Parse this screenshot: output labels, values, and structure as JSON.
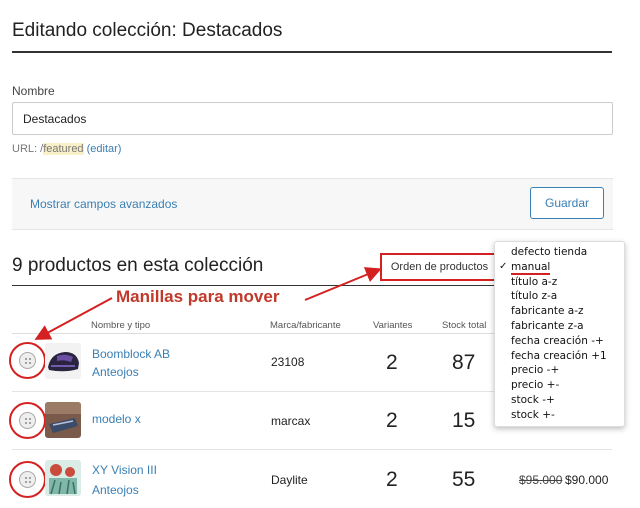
{
  "page": {
    "title": "Editando colección: Destacados"
  },
  "form": {
    "name_label": "Nombre",
    "name_value": "Destacados",
    "url_prefix": "URL: /",
    "url_path": "featured",
    "url_edit": "(editar)",
    "advanced_link": "Mostrar campos avanzados",
    "save_label": "Guardar"
  },
  "products": {
    "heading": "9 productos en esta colección",
    "sort_label": "Orden de productos"
  },
  "sort_menu": {
    "selected": "manual",
    "options": [
      "defecto tienda",
      "manual",
      "título a-z",
      "título z-a",
      "fabricante a-z",
      "fabricante z-a",
      "fecha creación -+",
      "fecha creación +1",
      "precio -+",
      "precio +-",
      "stock -+",
      "stock +-"
    ]
  },
  "annotation": {
    "callout": "Manillas para mover",
    "color": "#c0392b"
  },
  "table": {
    "columns": [
      "Nombre y tipo",
      "Marca/fabricante",
      "Variantes",
      "Stock total"
    ],
    "rows": [
      {
        "name": "Boomblock AB",
        "type": "Anteojos",
        "brand": "23108",
        "variants": "2",
        "stock": "87",
        "old_price": "",
        "price": "",
        "thumb": "helmet-image"
      },
      {
        "name": "modelo x",
        "type": "",
        "brand": "marcax",
        "variants": "2",
        "stock": "15",
        "old_price": "",
        "price": "",
        "thumb": "device-image"
      },
      {
        "name": "XY Vision III",
        "type": "Anteojos",
        "brand": "Daylite",
        "variants": "2",
        "stock": "55",
        "old_price": "$95.000",
        "price": "$90.000",
        "thumb": "art-image"
      }
    ]
  },
  "colors": {
    "accent": "#3a7fb3",
    "annotation_red": "#d42020"
  }
}
